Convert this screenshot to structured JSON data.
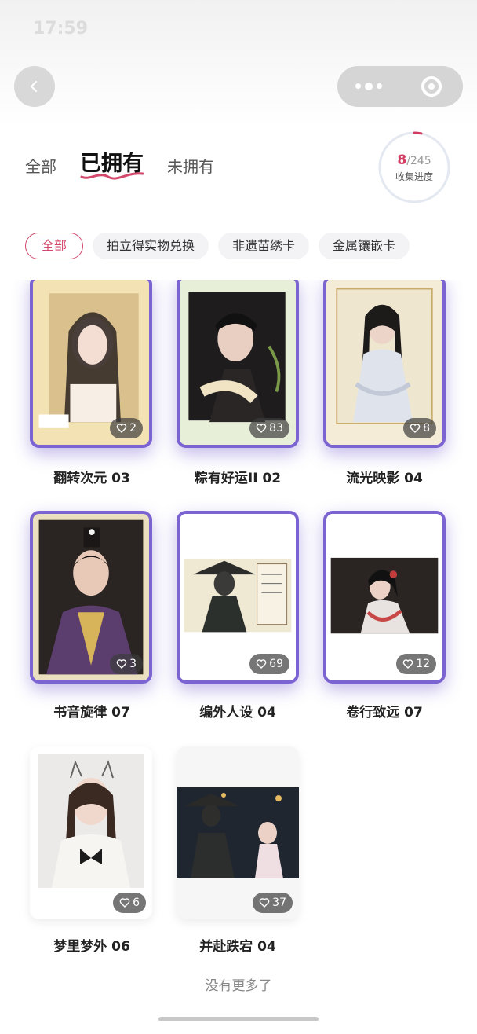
{
  "status": {
    "time": "17:59"
  },
  "tabs": [
    {
      "label": "全部"
    },
    {
      "label": "已拥有"
    },
    {
      "label": "未拥有"
    }
  ],
  "progress": {
    "owned": "8",
    "total": "/245",
    "label": "收集进度",
    "fraction": 0.033,
    "color": "#d43b63"
  },
  "chips": [
    {
      "label": "全部"
    },
    {
      "label": "拍立得实物兑换"
    },
    {
      "label": "非遗苗绣卡"
    },
    {
      "label": "金属镶嵌卡"
    }
  ],
  "cards": [
    {
      "title": "翻转次元 03",
      "likes": "2"
    },
    {
      "title": "粽有好运II 02",
      "likes": "83"
    },
    {
      "title": "流光映影 04",
      "likes": "8"
    },
    {
      "title": "书音旋律 07",
      "likes": "3"
    },
    {
      "title": "编外人设 04",
      "likes": "69"
    },
    {
      "title": "卷行致远 07",
      "likes": "12"
    },
    {
      "title": "梦里梦外 06",
      "likes": "6"
    },
    {
      "title": "并赴跌宕 04",
      "likes": "37"
    }
  ],
  "footer": {
    "text": "没有更多了"
  },
  "colors": {
    "accent": "#d4486c",
    "frame": "#7b63d1"
  }
}
